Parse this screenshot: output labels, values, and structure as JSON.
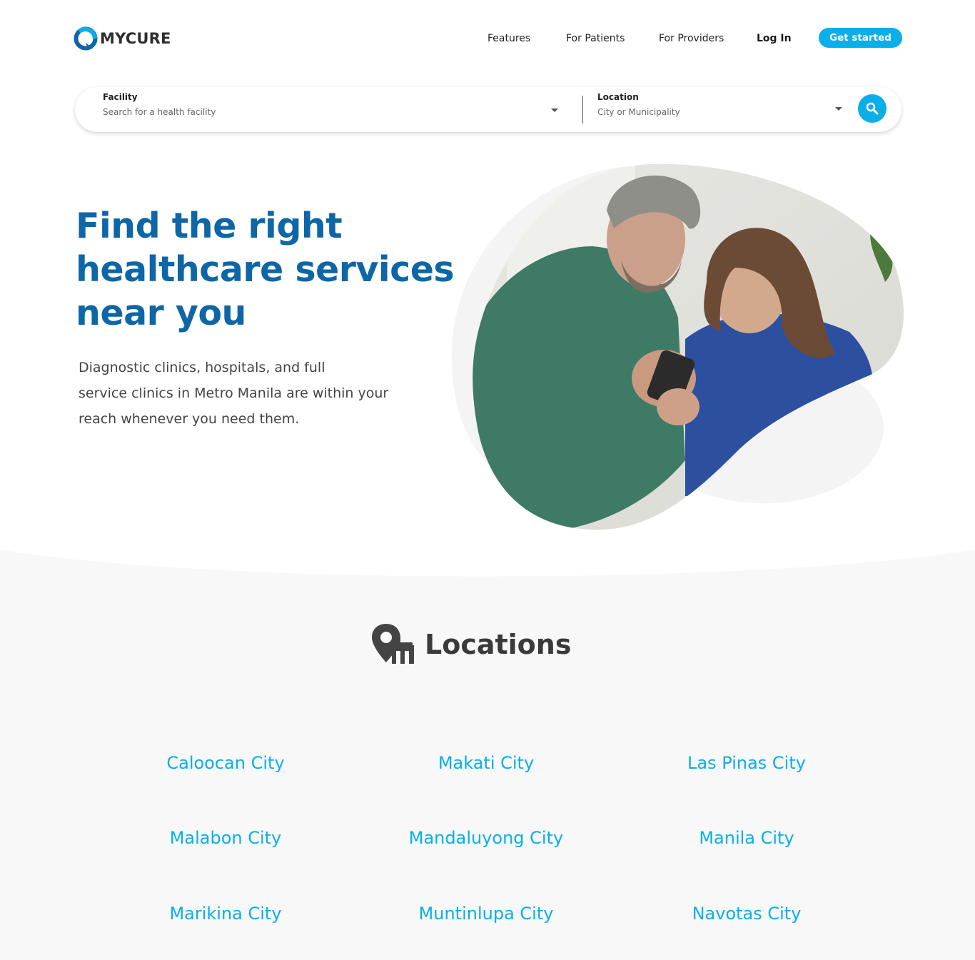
{
  "brand": {
    "name": "MYCURE",
    "accent": "#0aaee9",
    "heading_color": "#0d66a6"
  },
  "nav": {
    "features": "Features",
    "for_patients": "For Patients",
    "for_providers": "For Providers",
    "login": "Log In",
    "cta": "Get started"
  },
  "search": {
    "facility_label": "Facility",
    "facility_placeholder": "Search for a health facility",
    "location_label": "Location",
    "location_placeholder": "City or Municipality",
    "button_icon": "search-icon"
  },
  "hero": {
    "title_lines": [
      "Find the right",
      "healthcare services",
      "near you"
    ],
    "desc_lines": [
      "Diagnostic clinics, hospitals, and full",
      "service clinics in Metro Manila are within your",
      "reach whenever you need them."
    ],
    "image": "couple-looking-at-phone"
  },
  "locations": {
    "title": "Locations",
    "icon": "location-building-icon",
    "cities": [
      "Caloocan City",
      "Makati City",
      "Las Pinas City",
      "Malabon City",
      "Mandaluyong City",
      "Manila City",
      "Marikina City",
      "Muntinlupa City",
      "Navotas City"
    ]
  }
}
